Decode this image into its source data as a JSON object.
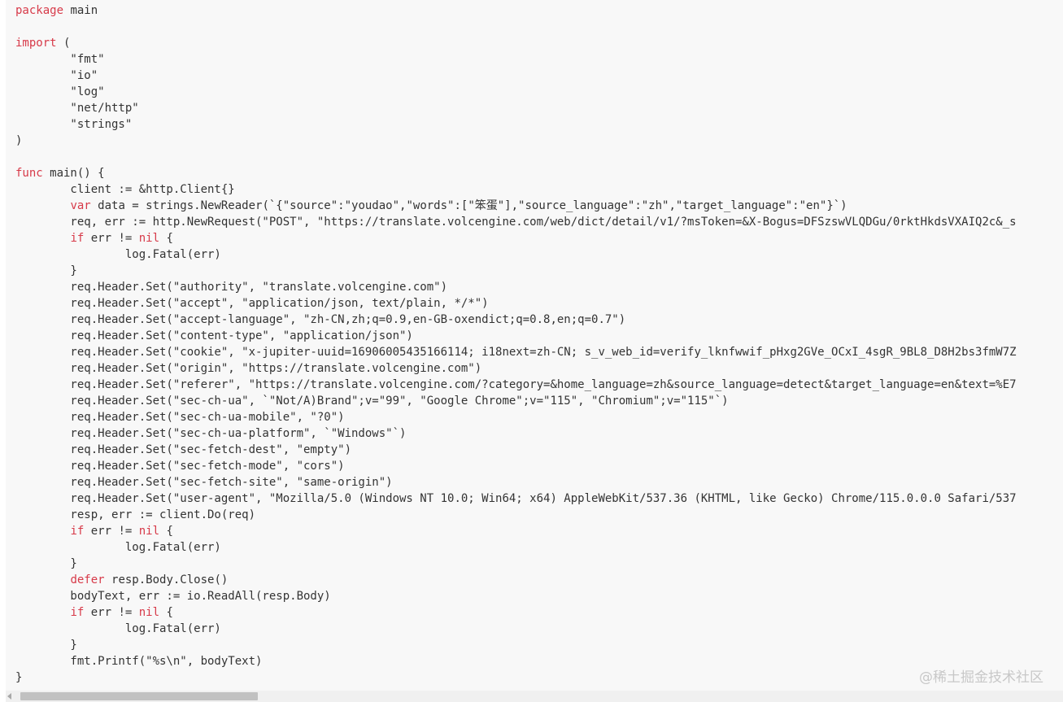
{
  "code_block": {
    "language": "go",
    "lines": [
      {
        "kw": "package",
        "text": " main"
      },
      {
        "kw": "",
        "text": ""
      },
      {
        "kw": "import",
        "text": " ("
      },
      {
        "kw": "",
        "text": "        \"fmt\""
      },
      {
        "kw": "",
        "text": "        \"io\""
      },
      {
        "kw": "",
        "text": "        \"log\""
      },
      {
        "kw": "",
        "text": "        \"net/http\""
      },
      {
        "kw": "",
        "text": "        \"strings\""
      },
      {
        "kw": "",
        "text": ")"
      },
      {
        "kw": "",
        "text": ""
      },
      {
        "kw": "func",
        "text": " main() {"
      },
      {
        "kw": "",
        "text": "        client := &http.Client{}"
      },
      {
        "indent": "        ",
        "kw": "var",
        "text": " data = strings.NewReader(`{\"source\":\"youdao\",\"words\":[\"笨蛋\"],\"source_language\":\"zh\",\"target_language\":\"en\"}`)"
      },
      {
        "kw": "",
        "text": "        req, err := http.NewRequest(\"POST\", \"https://translate.volcengine.com/web/dict/detail/v1/?msToken=&X-Bogus=DFSzswVLQDGu/0rktHkdsVXAIQ2c&_s"
      },
      {
        "indent": "        ",
        "kw": "if",
        "text": " err != ",
        "kw2": "nil",
        "text2": " {"
      },
      {
        "kw": "",
        "text": "                log.Fatal(err)"
      },
      {
        "kw": "",
        "text": "        }"
      },
      {
        "kw": "",
        "text": "        req.Header.Set(\"authority\", \"translate.volcengine.com\")"
      },
      {
        "kw": "",
        "text": "        req.Header.Set(\"accept\", \"application/json, text/plain, */*\")"
      },
      {
        "kw": "",
        "text": "        req.Header.Set(\"accept-language\", \"zh-CN,zh;q=0.9,en-GB-oxendict;q=0.8,en;q=0.7\")"
      },
      {
        "kw": "",
        "text": "        req.Header.Set(\"content-type\", \"application/json\")"
      },
      {
        "kw": "",
        "text": "        req.Header.Set(\"cookie\", \"x-jupiter-uuid=16906005435166114; i18next=zh-CN; s_v_web_id=verify_lknfwwif_pHxg2GVe_OCxI_4sgR_9BL8_D8H2bs3fmW7Z"
      },
      {
        "kw": "",
        "text": "        req.Header.Set(\"origin\", \"https://translate.volcengine.com\")"
      },
      {
        "kw": "",
        "text": "        req.Header.Set(\"referer\", \"https://translate.volcengine.com/?category=&home_language=zh&source_language=detect&target_language=en&text=%E7"
      },
      {
        "kw": "",
        "text": "        req.Header.Set(\"sec-ch-ua\", `\"Not/A)Brand\";v=\"99\", \"Google Chrome\";v=\"115\", \"Chromium\";v=\"115\"`)"
      },
      {
        "kw": "",
        "text": "        req.Header.Set(\"sec-ch-ua-mobile\", \"?0\")"
      },
      {
        "kw": "",
        "text": "        req.Header.Set(\"sec-ch-ua-platform\", `\"Windows\"`)"
      },
      {
        "kw": "",
        "text": "        req.Header.Set(\"sec-fetch-dest\", \"empty\")"
      },
      {
        "kw": "",
        "text": "        req.Header.Set(\"sec-fetch-mode\", \"cors\")"
      },
      {
        "kw": "",
        "text": "        req.Header.Set(\"sec-fetch-site\", \"same-origin\")"
      },
      {
        "kw": "",
        "text": "        req.Header.Set(\"user-agent\", \"Mozilla/5.0 (Windows NT 10.0; Win64; x64) AppleWebKit/537.36 (KHTML, like Gecko) Chrome/115.0.0.0 Safari/537"
      },
      {
        "kw": "",
        "text": "        resp, err := client.Do(req)"
      },
      {
        "indent": "        ",
        "kw": "if",
        "text": " err != ",
        "kw2": "nil",
        "text2": " {"
      },
      {
        "kw": "",
        "text": "                log.Fatal(err)"
      },
      {
        "kw": "",
        "text": "        }"
      },
      {
        "indent": "        ",
        "kw": "defer",
        "text": " resp.Body.Close()"
      },
      {
        "kw": "",
        "text": "        bodyText, err := io.ReadAll(resp.Body)"
      },
      {
        "indent": "        ",
        "kw": "if",
        "text": " err != ",
        "kw2": "nil",
        "text2": " {"
      },
      {
        "kw": "",
        "text": "                log.Fatal(err)"
      },
      {
        "kw": "",
        "text": "        }"
      },
      {
        "kw": "",
        "text": "        fmt.Printf(\"%s\\n\", bodyText)"
      },
      {
        "kw": "",
        "text": "}"
      }
    ]
  },
  "watermark": "@稀土掘金技术社区",
  "colors": {
    "keyword": "#d73a49",
    "text": "#333333",
    "code_background": "#f8f8f8"
  },
  "scrollbar": {
    "orientation": "horizontal",
    "left_arrow_icon": "chevron-left-icon",
    "scroll_position": 0.0
  }
}
